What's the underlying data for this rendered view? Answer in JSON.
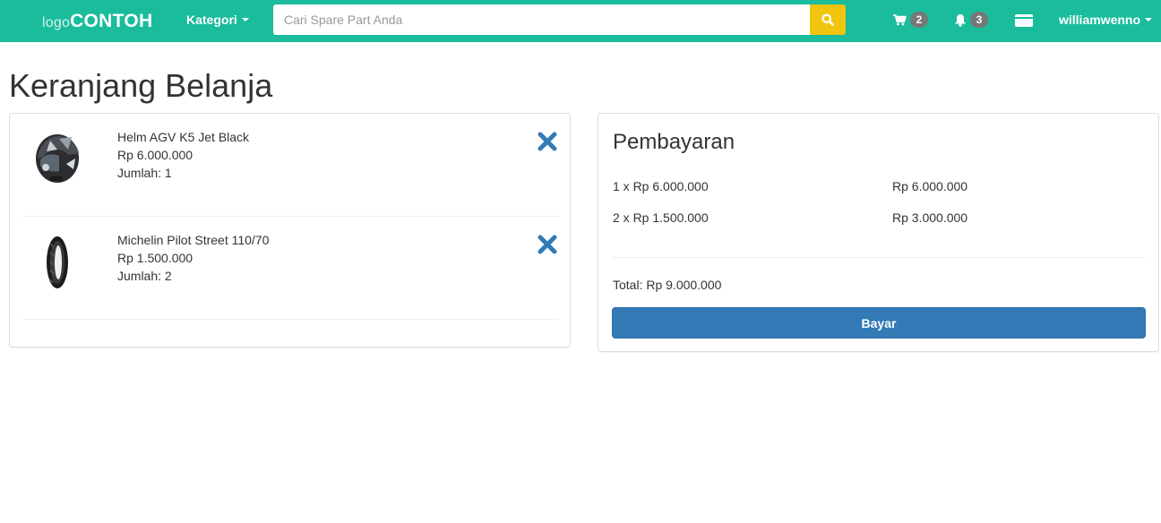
{
  "navbar": {
    "logo_small": "logo",
    "logo_big": "CONTOH",
    "kategori_label": "Kategori",
    "search_placeholder": "Cari Spare Part Anda",
    "search_value": "",
    "cart_count": "2",
    "notification_count": "3",
    "username": "williamwenno",
    "icons": {
      "search": "search-icon",
      "cart": "cart-icon",
      "bell": "bell-icon",
      "card": "credit-card-icon"
    }
  },
  "page": {
    "title": "Keranjang Belanja"
  },
  "cart": {
    "items": [
      {
        "name": "Helm AGV K5 Jet Black",
        "price": "Rp 6.000.000",
        "quantity": "Jumlah: 1",
        "image": "helmet-image"
      },
      {
        "name": "Michelin Pilot Street 110/70",
        "price": "Rp 1.500.000",
        "quantity": "Jumlah: 2",
        "image": "tire-image"
      }
    ]
  },
  "payment": {
    "title": "Pembayaran",
    "lines": [
      {
        "desc": "1 x Rp 6.000.000",
        "amount": "Rp 6.000.000"
      },
      {
        "desc": "2 x Rp 1.500.000",
        "amount": "Rp 3.000.000"
      }
    ],
    "total": "Total: Rp 9.000.000",
    "button_label": "Bayar"
  },
  "colors": {
    "navbar": "#1abc9c",
    "search_button": "#f1c40f",
    "primary": "#337ab7",
    "badge": "#777777"
  }
}
